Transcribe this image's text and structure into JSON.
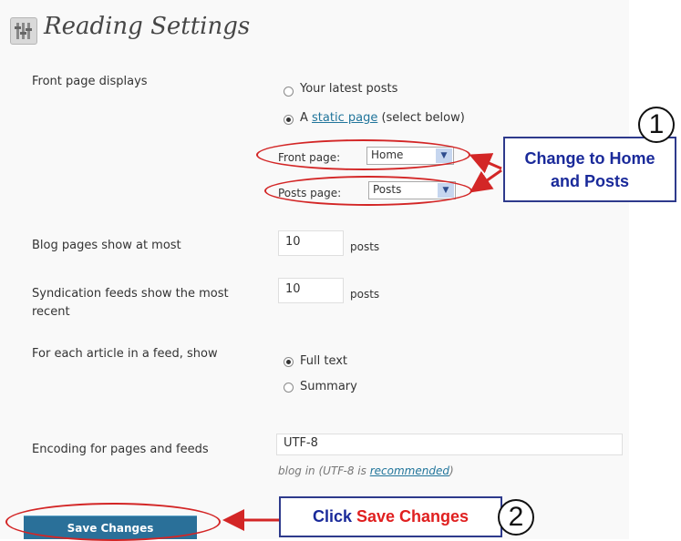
{
  "page": {
    "title": "Reading Settings"
  },
  "icons": {
    "title_icon": "settings-page-icon"
  },
  "settings": {
    "front_page_displays": {
      "label": "Front page displays",
      "option_latest": "Your latest posts",
      "option_static_prefix": "A ",
      "option_static_link": "static page",
      "option_static_suffix": " (select below)",
      "selected": "static"
    },
    "front_page_select": {
      "label": "Front page:",
      "value": "Home"
    },
    "posts_page_select": {
      "label": "Posts page:",
      "value": "Posts"
    },
    "blog_pages": {
      "label": "Blog pages show at most",
      "value": "10",
      "unit": "posts"
    },
    "syndication": {
      "label": "Syndication feeds show the most recent",
      "value": "10",
      "unit": "posts"
    },
    "feed_article": {
      "label": "For each article in a feed, show",
      "option_full": "Full text",
      "option_summary": "Summary",
      "selected": "full"
    },
    "encoding": {
      "label": "Encoding for pages and feeds",
      "value": "UTF-8",
      "note_prefix": "blog in (UTF-8 is ",
      "note_link": "recommended",
      "note_suffix": ")"
    }
  },
  "buttons": {
    "save_label": "Save Changes"
  },
  "annotations": {
    "callout1_line1": "Change to Home",
    "callout1_line2": "and Posts",
    "callout1_number": "1",
    "callout2_prefix": "Click ",
    "callout2_highlight": "Save Changes",
    "callout2_number": "2",
    "colors": {
      "ellipse": "#d32626",
      "callout_text": "#1a2a9a",
      "callout_border": "#2e3a8c",
      "highlight": "#e02020"
    }
  }
}
